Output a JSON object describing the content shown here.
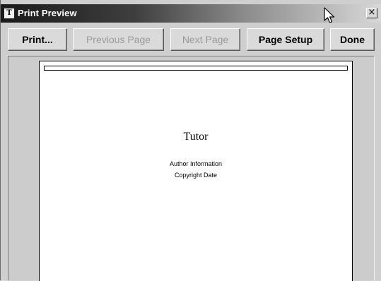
{
  "window": {
    "title": "Print Preview",
    "app_icon": "app-logo-icon",
    "close_label": "×"
  },
  "toolbar": {
    "print_label": "Print...",
    "previous_page_label": "Previous Page",
    "next_page_label": "Next Page",
    "page_setup_label": "Page Setup",
    "done_label": "Done"
  },
  "page": {
    "title": "Tutor",
    "author_info": "Author Information",
    "copyright": "Copyright Date"
  },
  "icons": {
    "cursor": "mouse-pointer-icon",
    "close": "close-icon"
  }
}
